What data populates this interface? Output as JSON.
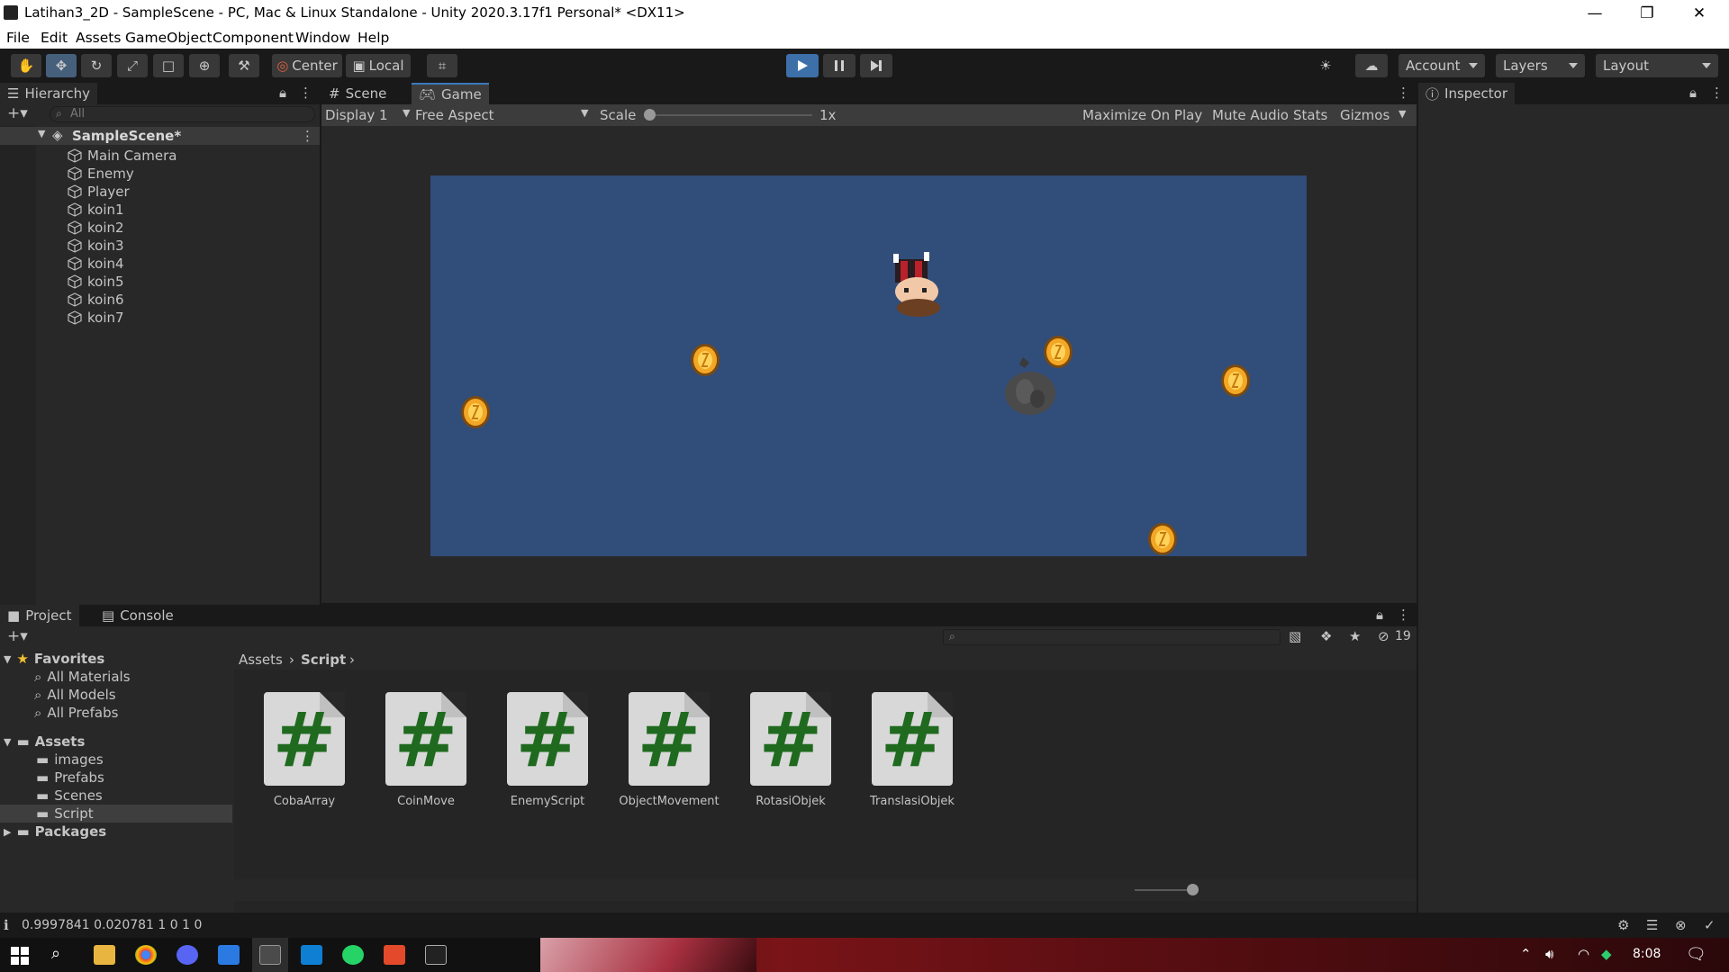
{
  "window": {
    "title": "Latihan3_2D - SampleScene - PC, Mac & Linux Standalone - Unity 2020.3.17f1 Personal* <DX11>"
  },
  "menu": [
    "File",
    "Edit",
    "Assets",
    "GameObject",
    "Component",
    "Window",
    "Help"
  ],
  "toolbar": {
    "pivot_label": "Center",
    "space_label": "Local",
    "account_label": "Account",
    "layers_label": "Layers",
    "layout_label": "Layout"
  },
  "hierarchy": {
    "tab_label": "Hierarchy",
    "search_placeholder": "All",
    "scene_name": "SampleScene*",
    "items": [
      "Main Camera",
      "Enemy",
      "Player",
      "koin1",
      "koin2",
      "koin3",
      "koin4",
      "koin5",
      "koin6",
      "koin7"
    ]
  },
  "scene_tab": "Scene",
  "game": {
    "tab_label": "Game",
    "display": "Display 1",
    "aspect": "Free Aspect",
    "scale_label": "Scale",
    "scale_value": "1x",
    "maximize": "Maximize On Play",
    "mute": "Mute Audio",
    "stats": "Stats",
    "gizmos": "Gizmos",
    "background_color": "#314d79"
  },
  "inspector": {
    "tab_label": "Inspector"
  },
  "project": {
    "tab_label": "Project",
    "console_tab": "Console",
    "hidden_count": "19",
    "favorites_label": "Favorites",
    "favorites": [
      "All Materials",
      "All Models",
      "All Prefabs"
    ],
    "assets_label": "Assets",
    "asset_folders": [
      "images",
      "Prefabs",
      "Scenes",
      "Script"
    ],
    "packages_label": "Packages",
    "breadcrumb": [
      "Assets",
      "Script"
    ],
    "scripts": [
      "CobaArray",
      "CoinMove",
      "EnemyScript",
      "ObjectMovement",
      "RotasiObjek",
      "TranslasiObjek"
    ]
  },
  "status": {
    "text": "0.9997841 0.020781 1 0 1 0"
  },
  "taskbar": {
    "time": "8:08"
  }
}
